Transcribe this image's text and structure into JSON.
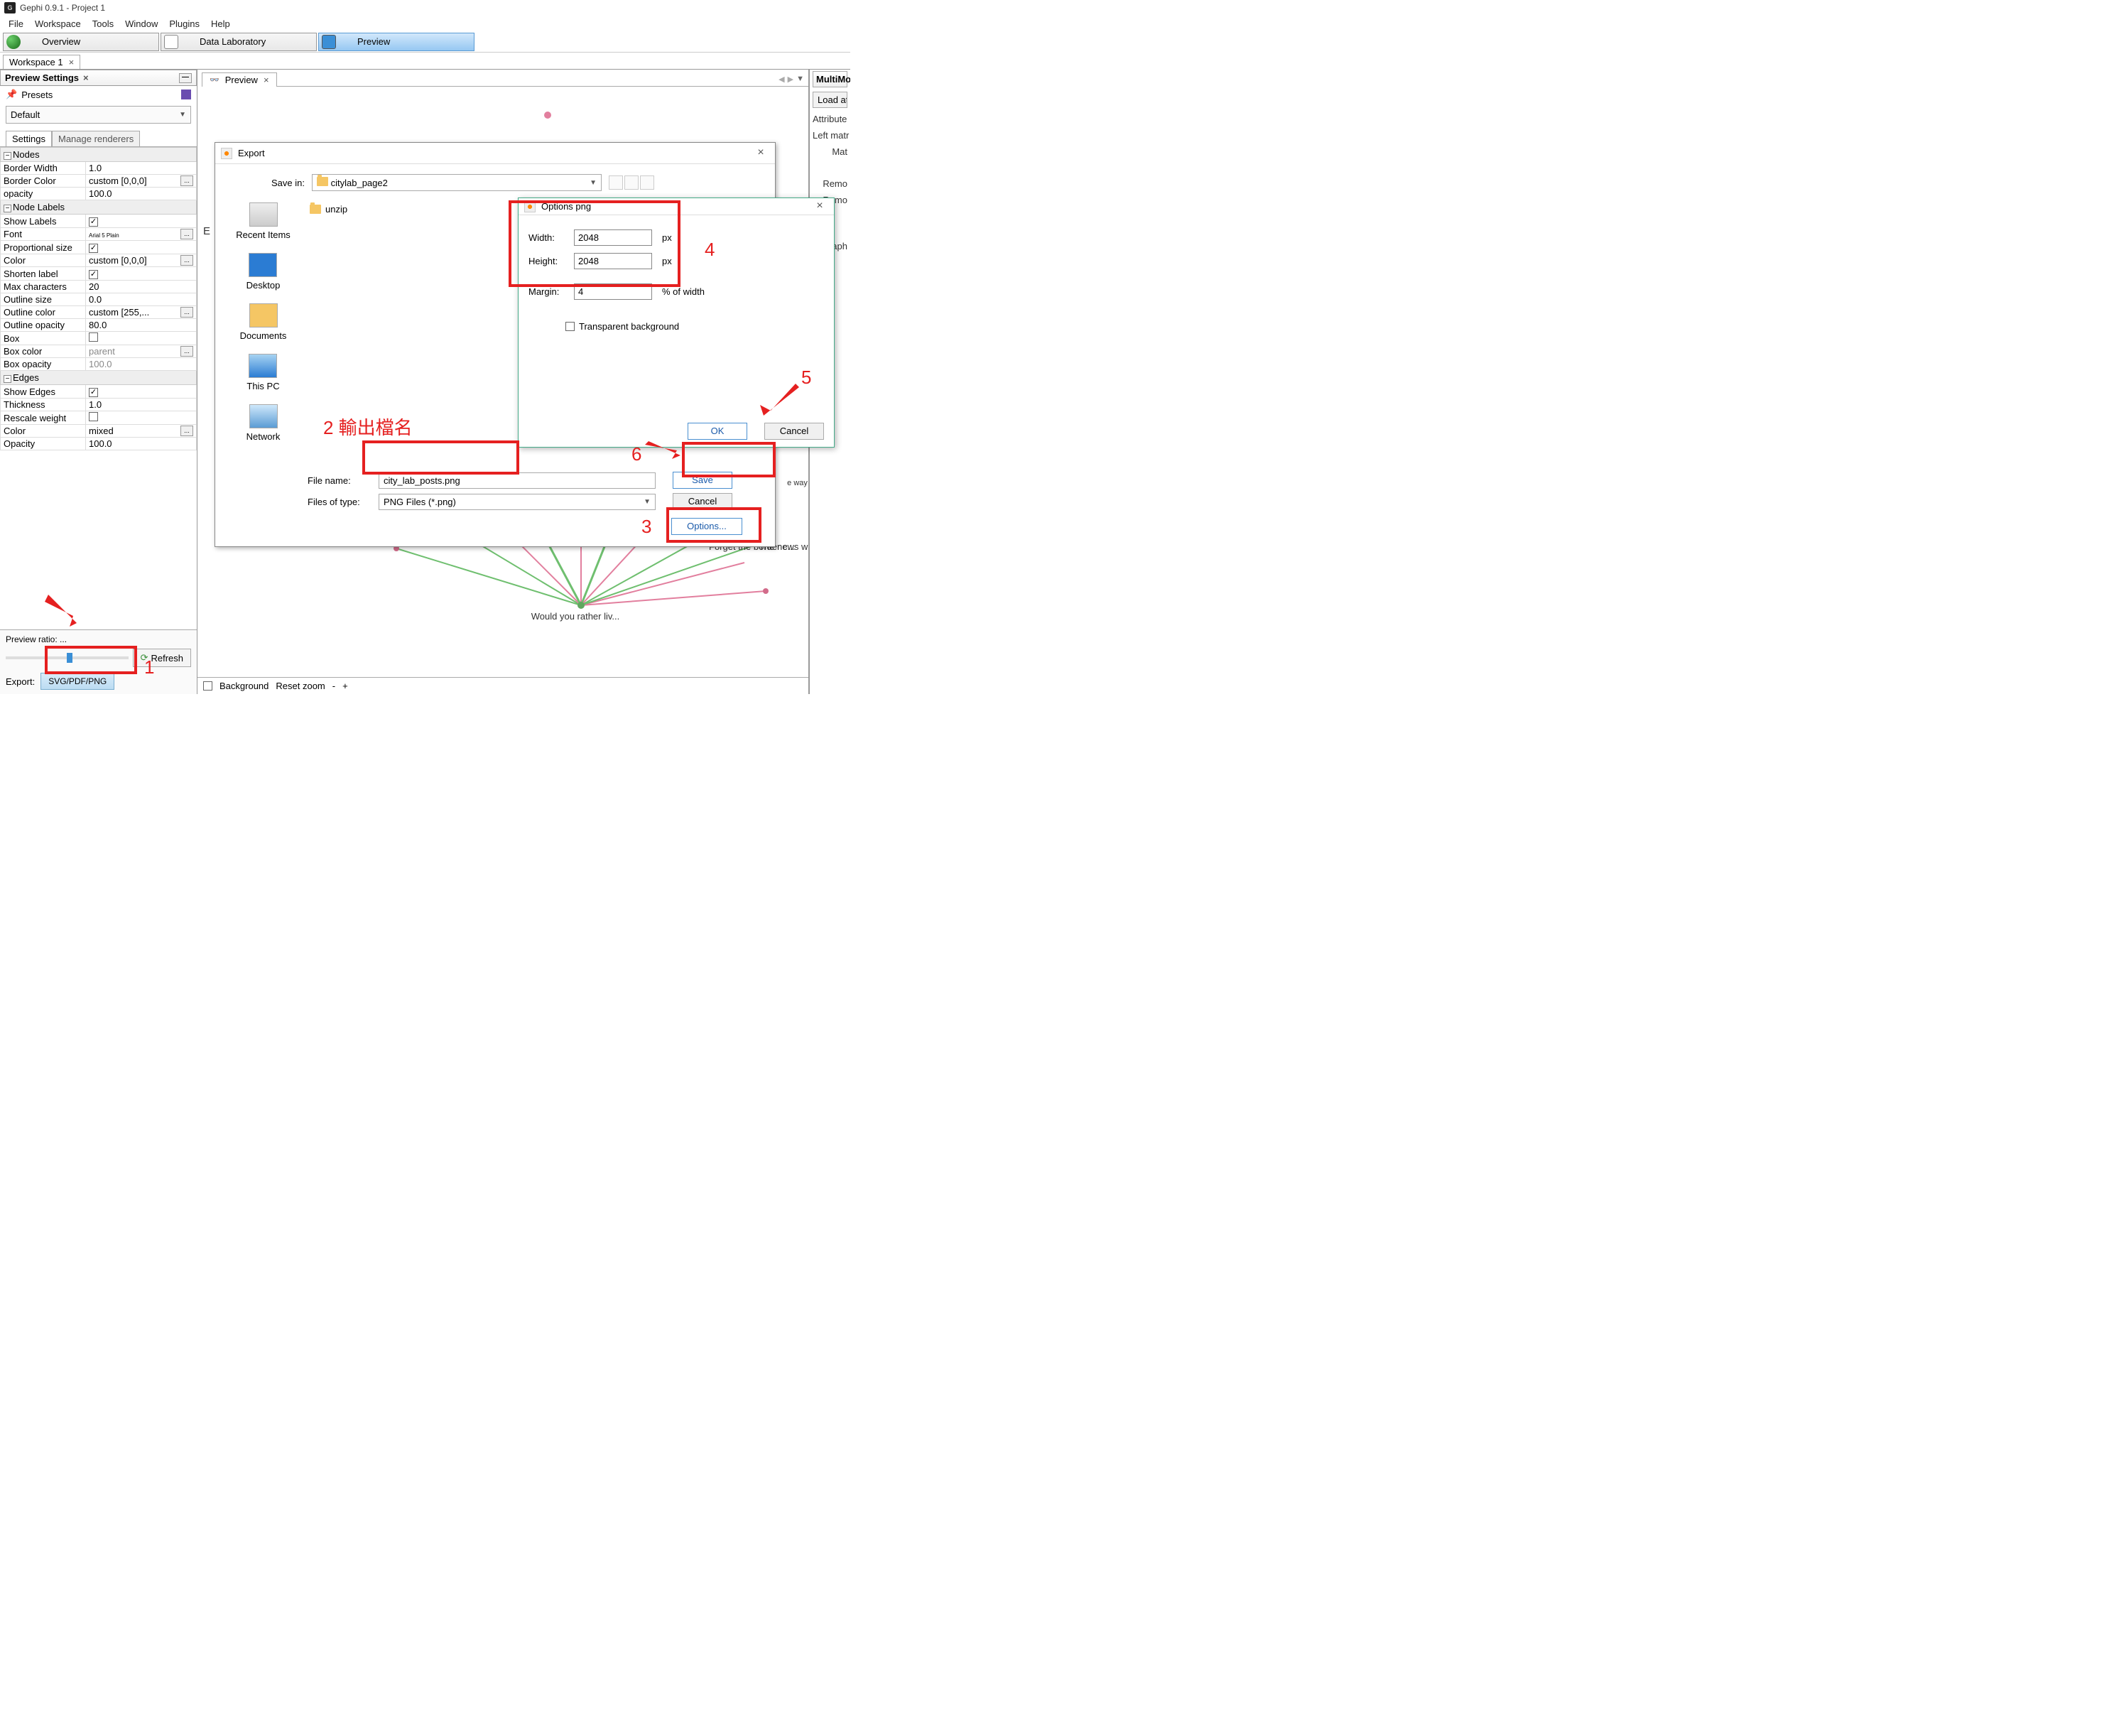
{
  "app": {
    "title": "Gephi 0.9.1 - Project 1"
  },
  "menu": [
    "File",
    "Workspace",
    "Tools",
    "Window",
    "Plugins",
    "Help"
  ],
  "views": [
    {
      "label": "Overview",
      "active": false
    },
    {
      "label": "Data Laboratory",
      "active": false
    },
    {
      "label": "Preview",
      "active": true
    }
  ],
  "workspace_tab": "Workspace 1",
  "left": {
    "panel_title": "Preview Settings",
    "presets_label": "Presets",
    "preset_selected": "Default",
    "subtabs": [
      "Settings",
      "Manage renderers"
    ],
    "sections": {
      "nodes": {
        "title": "Nodes",
        "props": [
          {
            "k": "Border Width",
            "v": "1.0"
          },
          {
            "k": "Border Color",
            "v": "custom [0,0,0]",
            "btn": true
          },
          {
            "k": "opacity",
            "v": "100.0"
          }
        ]
      },
      "node_labels": {
        "title": "Node Labels",
        "props": [
          {
            "k": "Show Labels",
            "chk": true
          },
          {
            "k": "Font",
            "v": "Arial 5 Plain",
            "btn": true
          },
          {
            "k": "Proportional size",
            "chk": true
          },
          {
            "k": "Color",
            "v": "custom [0,0,0]",
            "btn": true
          },
          {
            "k": "Shorten label",
            "chk": true
          },
          {
            "k": "Max characters",
            "v": "20"
          },
          {
            "k": "Outline size",
            "v": "0.0"
          },
          {
            "k": "Outline color",
            "v": "custom [255,...",
            "btn": true
          },
          {
            "k": "Outline opacity",
            "v": "80.0"
          },
          {
            "k": "Box",
            "chk": false
          },
          {
            "k": "Box color",
            "v": "parent",
            "btn": true
          },
          {
            "k": "Box opacity",
            "v": "100.0"
          }
        ]
      },
      "edges": {
        "title": "Edges",
        "props": [
          {
            "k": "Show Edges",
            "chk": true
          },
          {
            "k": "Thickness",
            "v": "1.0"
          },
          {
            "k": "Rescale weight",
            "chk": false
          },
          {
            "k": "Color",
            "v": "mixed",
            "btn": true
          },
          {
            "k": "Opacity",
            "v": "100.0"
          }
        ]
      }
    },
    "preview_ratio_label": "Preview ratio: ...",
    "refresh_label": "Refresh",
    "export_label": "Export:",
    "svgpdf_label": "SVG/PDF/PNG"
  },
  "center": {
    "tab_label": "Preview",
    "bottom_bg_label": "Background",
    "bottom_reset_label": "Reset zoom",
    "bottom_minus": "-",
    "bottom_plus": "+",
    "graph_labels": [
      "Would you rather liv...",
      "Forget the border c...",
      "The news was social ..."
    ],
    "way_text": "e way ."
  },
  "right": {
    "header": "MultiMod",
    "load_btn": "Load att",
    "attr_label": "Attribute",
    "left_matr": "Left matr",
    "mat": "Mat",
    "remo1": "Remo",
    "remo2": "Remo",
    "raph": "raph"
  },
  "export_dialog": {
    "title": "Export",
    "save_in_label": "Save in:",
    "save_in_folder": "citylab_page2",
    "file_item": "unzip",
    "places": [
      "Recent Items",
      "Desktop",
      "Documents",
      "This PC",
      "Network"
    ],
    "filename_label": "File name:",
    "filename_value": "city_lab_posts.png",
    "filetype_label": "Files of type:",
    "filetype_value": "PNG Files (*.png)",
    "save_btn": "Save",
    "cancel_btn": "Cancel",
    "options_btn": "Options..."
  },
  "options_dialog": {
    "title": "Options png",
    "width_label": "Width:",
    "width_value": "2048",
    "height_label": "Height:",
    "height_value": "2048",
    "px": "px",
    "margin_label": "Margin:",
    "margin_value": "4",
    "margin_unit": "% of width",
    "transparent_label": "Transparent background",
    "ok": "OK",
    "cancel": "Cancel"
  },
  "annot": {
    "n1": "1",
    "n2_text": "2  輸出檔名",
    "n3": "3",
    "n4": "4",
    "n5": "5",
    "n6": "6"
  }
}
